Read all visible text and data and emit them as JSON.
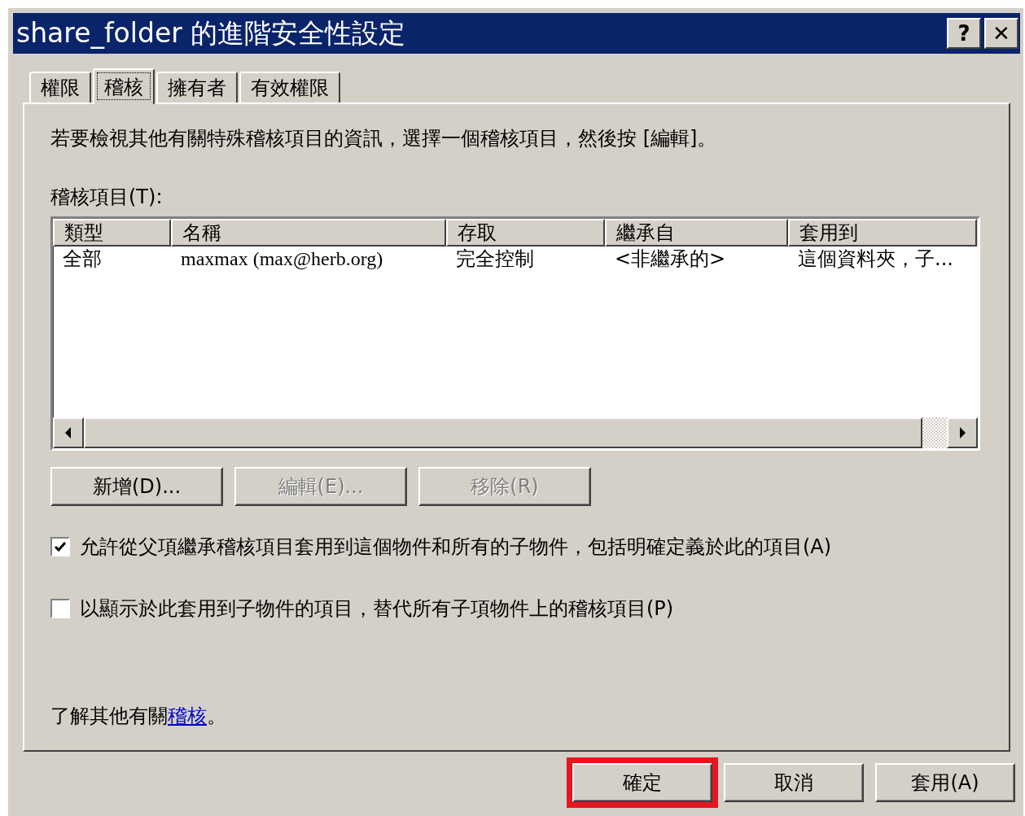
{
  "window": {
    "title": "share_folder 的進階安全性設定",
    "help_button": "?",
    "close_button": "✕"
  },
  "tabs": [
    {
      "label": "權限",
      "selected": false
    },
    {
      "label": "稽核",
      "selected": true
    },
    {
      "label": "擁有者",
      "selected": false
    },
    {
      "label": "有效權限",
      "selected": false
    }
  ],
  "instructions": "若要檢視其他有關特殊稽核項目的資訊，選擇一個稽核項目，然後按 [編輯]。",
  "list_label": "稽核項目(T):",
  "table": {
    "columns": [
      "類型",
      "名稱",
      "存取",
      "繼承自",
      "套用到"
    ],
    "rows": [
      {
        "cells": [
          "全部",
          "maxmax (max@herb.org)",
          "完全控制",
          "<非繼承的>",
          "這個資料夾，子..."
        ],
        "selected": false
      }
    ]
  },
  "entry_buttons": [
    {
      "label": "新增(D)...",
      "disabled": false
    },
    {
      "label": "編輯(E)...",
      "disabled": true
    },
    {
      "label": "移除(R)",
      "disabled": true
    }
  ],
  "options": [
    {
      "label": "允許從父項繼承稽核項目套用到這個物件和所有的子物件，包括明確定義於此的項目(A)",
      "checked": true
    },
    {
      "label": "以顯示於此套用到子物件的項目，替代所有子項物件上的稽核項目(P)",
      "checked": false
    }
  ],
  "learn_more": {
    "before": "了解其他有關",
    "link": "稽核",
    "after": "。"
  },
  "dialog_buttons": [
    {
      "label": "確定",
      "highlighted": true
    },
    {
      "label": "取消",
      "highlighted": false
    },
    {
      "label": "套用(A)",
      "highlighted": false
    }
  ]
}
